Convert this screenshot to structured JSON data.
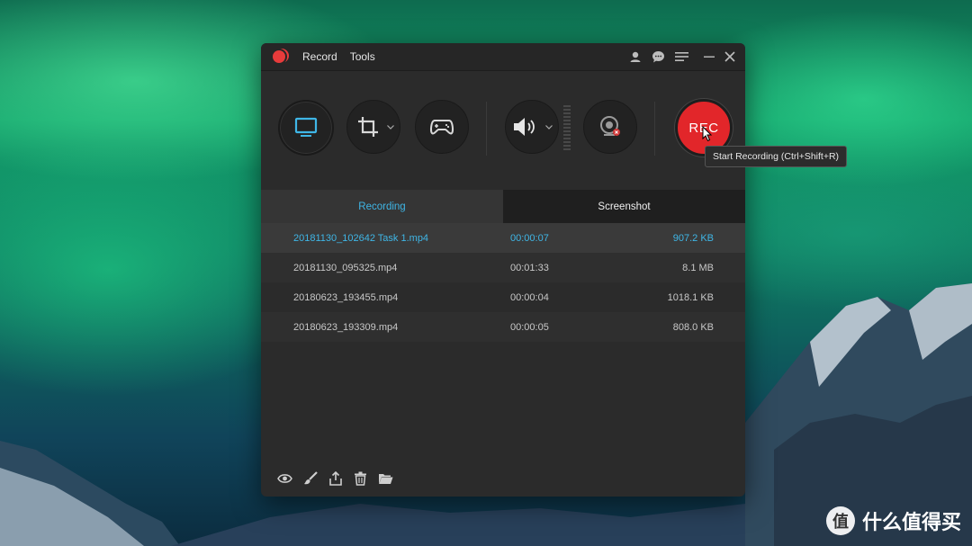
{
  "menu": {
    "record": "Record",
    "tools": "Tools"
  },
  "rec_button": {
    "label": "REC",
    "tooltip": "Start Recording (Ctrl+Shift+R)"
  },
  "tabs": {
    "recording": "Recording",
    "screenshot": "Screenshot"
  },
  "files": [
    {
      "name": "20181130_102642 Task 1.mp4",
      "duration": "00:00:07",
      "size": "907.2 KB"
    },
    {
      "name": "20181130_095325.mp4",
      "duration": "00:01:33",
      "size": "8.1 MB"
    },
    {
      "name": "20180623_193455.mp4",
      "duration": "00:00:04",
      "size": "1018.1 KB"
    },
    {
      "name": "20180623_193309.mp4",
      "duration": "00:00:05",
      "size": "808.0 KB"
    }
  ],
  "watermark": {
    "text": "什么值得买",
    "logo_char": "值"
  },
  "colors": {
    "accent": "#3fb6e6",
    "rec_red": "#e2262a"
  },
  "icons": [
    "user-icon",
    "chat-icon",
    "menu-icon",
    "minimize-icon",
    "close-icon",
    "screen-icon",
    "crop-icon",
    "gamepad-icon",
    "speaker-icon",
    "webcam-icon",
    "list-icon",
    "history-icon",
    "alarm-icon",
    "eye-icon",
    "brush-icon",
    "share-icon",
    "trash-icon",
    "folder-icon"
  ]
}
